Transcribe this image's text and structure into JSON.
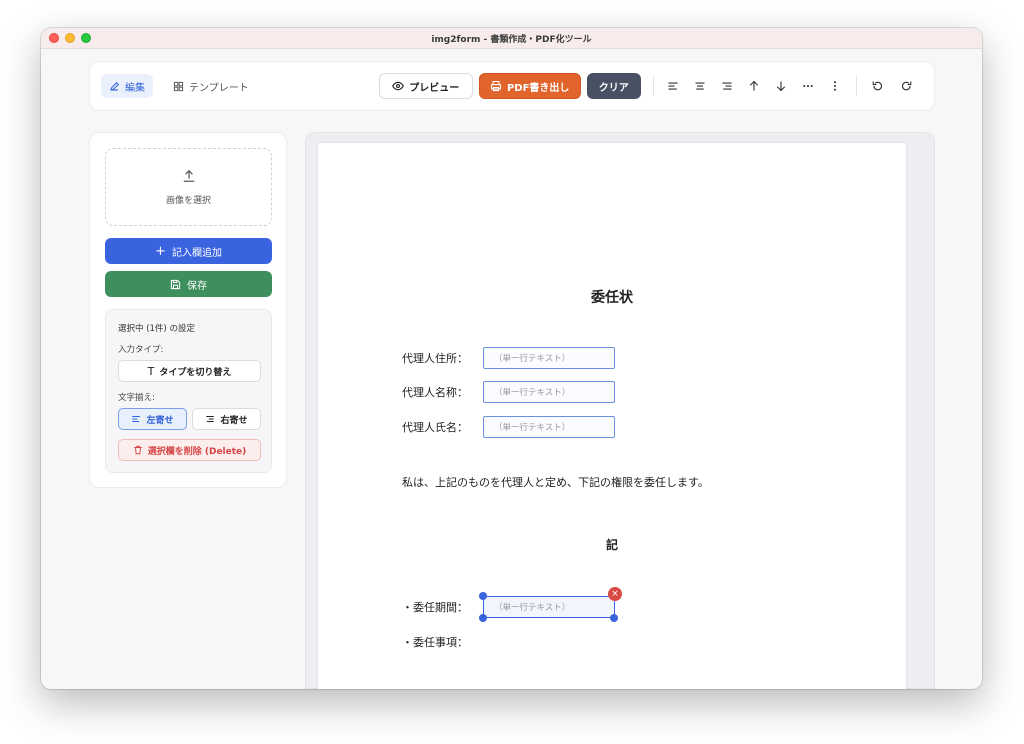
{
  "window": {
    "title": "img2form - 書類作成・PDF化ツール"
  },
  "tabs": [
    {
      "label": "編集",
      "active": true
    },
    {
      "label": "テンプレート",
      "active": false
    }
  ],
  "toolbar": {
    "preview_label": "プレビュー",
    "pdf_label": "PDF書き出し",
    "clear_label": "クリア"
  },
  "sidebar": {
    "upload_label": "画像を選択",
    "add_field_label": "記入欄追加",
    "save_label": "保存",
    "settings": {
      "title": "選択中 (1件) の設定",
      "input_type_label": "入力タイプ:",
      "toggle_type_label": "タイプを切り替え",
      "align_label": "文字揃え:",
      "align_left_label": "左寄せ",
      "align_right_label": "右寄せ",
      "delete_label": "選択欄を削除 (Delete)"
    }
  },
  "document": {
    "title": "委任状",
    "rows": [
      {
        "label": "代理人住所：",
        "placeholder": "（単一行テキスト）"
      },
      {
        "label": "代理人名称：",
        "placeholder": "（単一行テキスト）"
      },
      {
        "label": "代理人氏名：",
        "placeholder": "（単一行テキスト）"
      }
    ],
    "body": "私は、上記のものを代理人と定め、下記の権限を委任します。",
    "ki": "記",
    "items": [
      {
        "label": "・委任期間：",
        "placeholder": "（単一行テキスト）"
      },
      {
        "label": "・委任事項："
      }
    ],
    "delete_badge": "×"
  },
  "colors": {
    "primary": "#3a63e0",
    "save": "#3d8f5e",
    "pdf": "#e0642b",
    "clear": "#475163",
    "danger": "#d94a45"
  }
}
